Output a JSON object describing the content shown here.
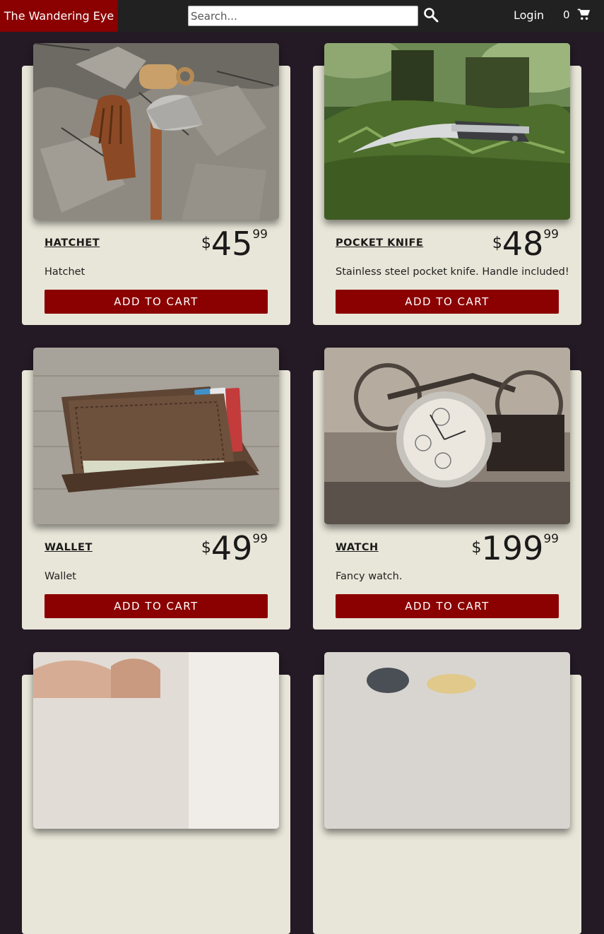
{
  "header": {
    "brand": "The Wandering Eye",
    "search_placeholder": "Search...",
    "login_label": "Login",
    "cart_count": "0"
  },
  "products": [
    {
      "title": "HATCHET",
      "currency": "$",
      "price_whole": "45",
      "price_cents": "99",
      "description": "Hatchet",
      "button": "ADD TO CART",
      "image": "hatchet-gloves-on-rock"
    },
    {
      "title": "POCKET KNIFE",
      "currency": "$",
      "price_whole": "48",
      "price_cents": "99",
      "description": "Stainless steel pocket knife. Handle included!",
      "button": "ADD TO CART",
      "image": "knife-on-moss"
    },
    {
      "title": "WALLET",
      "currency": "$",
      "price_whole": "49",
      "price_cents": "99",
      "description": "Wallet",
      "button": "ADD TO CART",
      "image": "leather-wallet"
    },
    {
      "title": "WATCH",
      "currency": "$",
      "price_whole": "199",
      "price_cents": "99",
      "description": "Fancy watch.",
      "button": "ADD TO CART",
      "image": "wristwatch"
    },
    {
      "image": "product-photo-partial"
    },
    {
      "image": "product-photo-partial"
    }
  ],
  "colors": {
    "accent": "#8b0000",
    "background": "#241a25",
    "card": "#e8e6d8",
    "header": "#212121"
  }
}
